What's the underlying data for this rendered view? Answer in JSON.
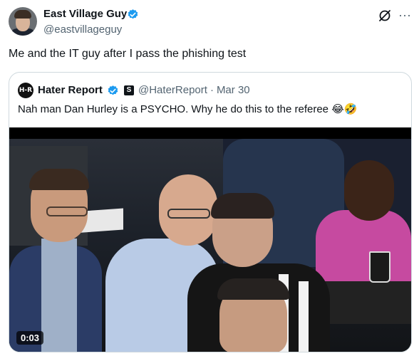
{
  "author": {
    "name": "East Village Guy",
    "handle": "@eastvillageguy",
    "avatar_icon": "profile-photo"
  },
  "header_actions": {
    "grok_icon": "grok-icon",
    "more_icon": "more-icon",
    "more_glyph": "···"
  },
  "tweet": {
    "text": "Me and the IT guy after I pass the phishing test"
  },
  "quote": {
    "avatar_text": "H-R",
    "name": "Hater Report",
    "handle": "@HaterReport",
    "separator": "·",
    "date": "Mar 30",
    "text": "Nah man Dan Hurley is a PSYCHO. Why he do this to the referee 😂🤣",
    "badge_glyph": "S",
    "video": {
      "duration": "0:03"
    }
  },
  "colors": {
    "verified_blue": "#1d9bf0",
    "text_primary": "#0f1419",
    "text_secondary": "#536471",
    "border": "#cfd9de"
  }
}
